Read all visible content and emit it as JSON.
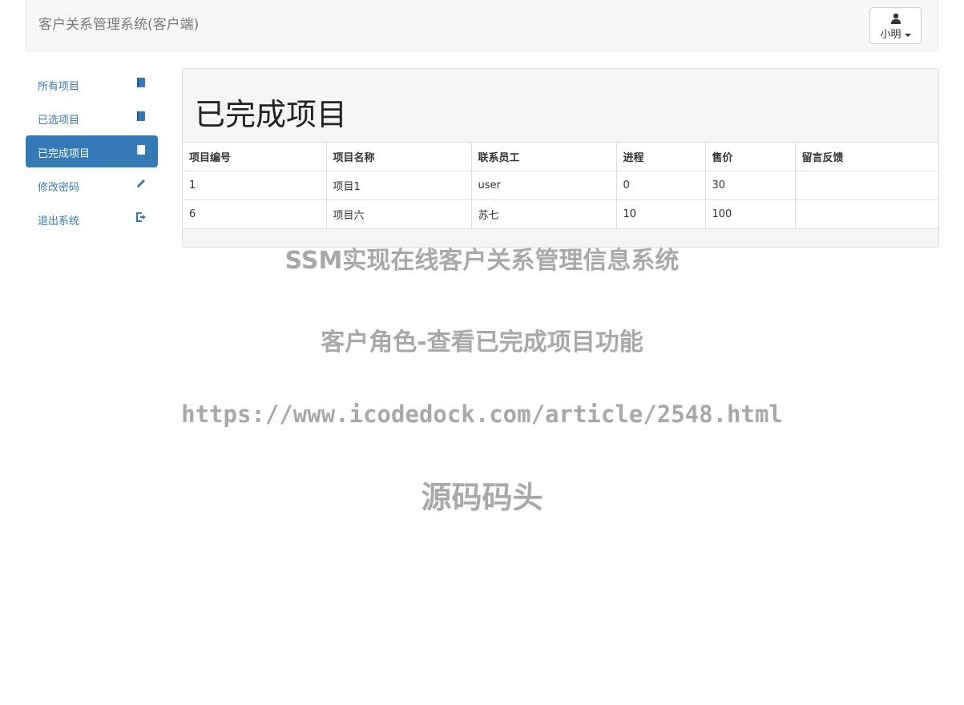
{
  "navbar": {
    "brand": "客户关系管理系统(客户端)",
    "user_name": "小明"
  },
  "sidebar": {
    "items": [
      {
        "label": "所有项目",
        "icon": "book-icon",
        "active": false
      },
      {
        "label": "已选项目",
        "icon": "book-icon",
        "active": false
      },
      {
        "label": "已完成项目",
        "icon": "book-icon",
        "active": true
      },
      {
        "label": "修改密码",
        "icon": "pencil-icon",
        "active": false
      },
      {
        "label": "退出系统",
        "icon": "logout-icon",
        "active": false
      }
    ]
  },
  "main": {
    "title": "已完成项目",
    "table": {
      "headers": [
        "项目编号",
        "项目名称",
        "联系员工",
        "进程",
        "售价",
        "留言反馈"
      ],
      "rows": [
        [
          "1",
          "项目1",
          "user",
          "0",
          "30",
          ""
        ],
        [
          "6",
          "项目六",
          "苏七",
          "10",
          "100",
          ""
        ]
      ]
    }
  },
  "watermark": {
    "line1": "SSM实现在线客户关系管理信息系统",
    "line2": "客户角色-查看已完成项目功能",
    "line3": "https://www.icodedock.com/article/2548.html",
    "line4": "源码码头"
  },
  "colors": {
    "accent": "#337ab7",
    "navbar_bg": "#f8f8f8",
    "panel_bg": "#f5f5f5"
  }
}
